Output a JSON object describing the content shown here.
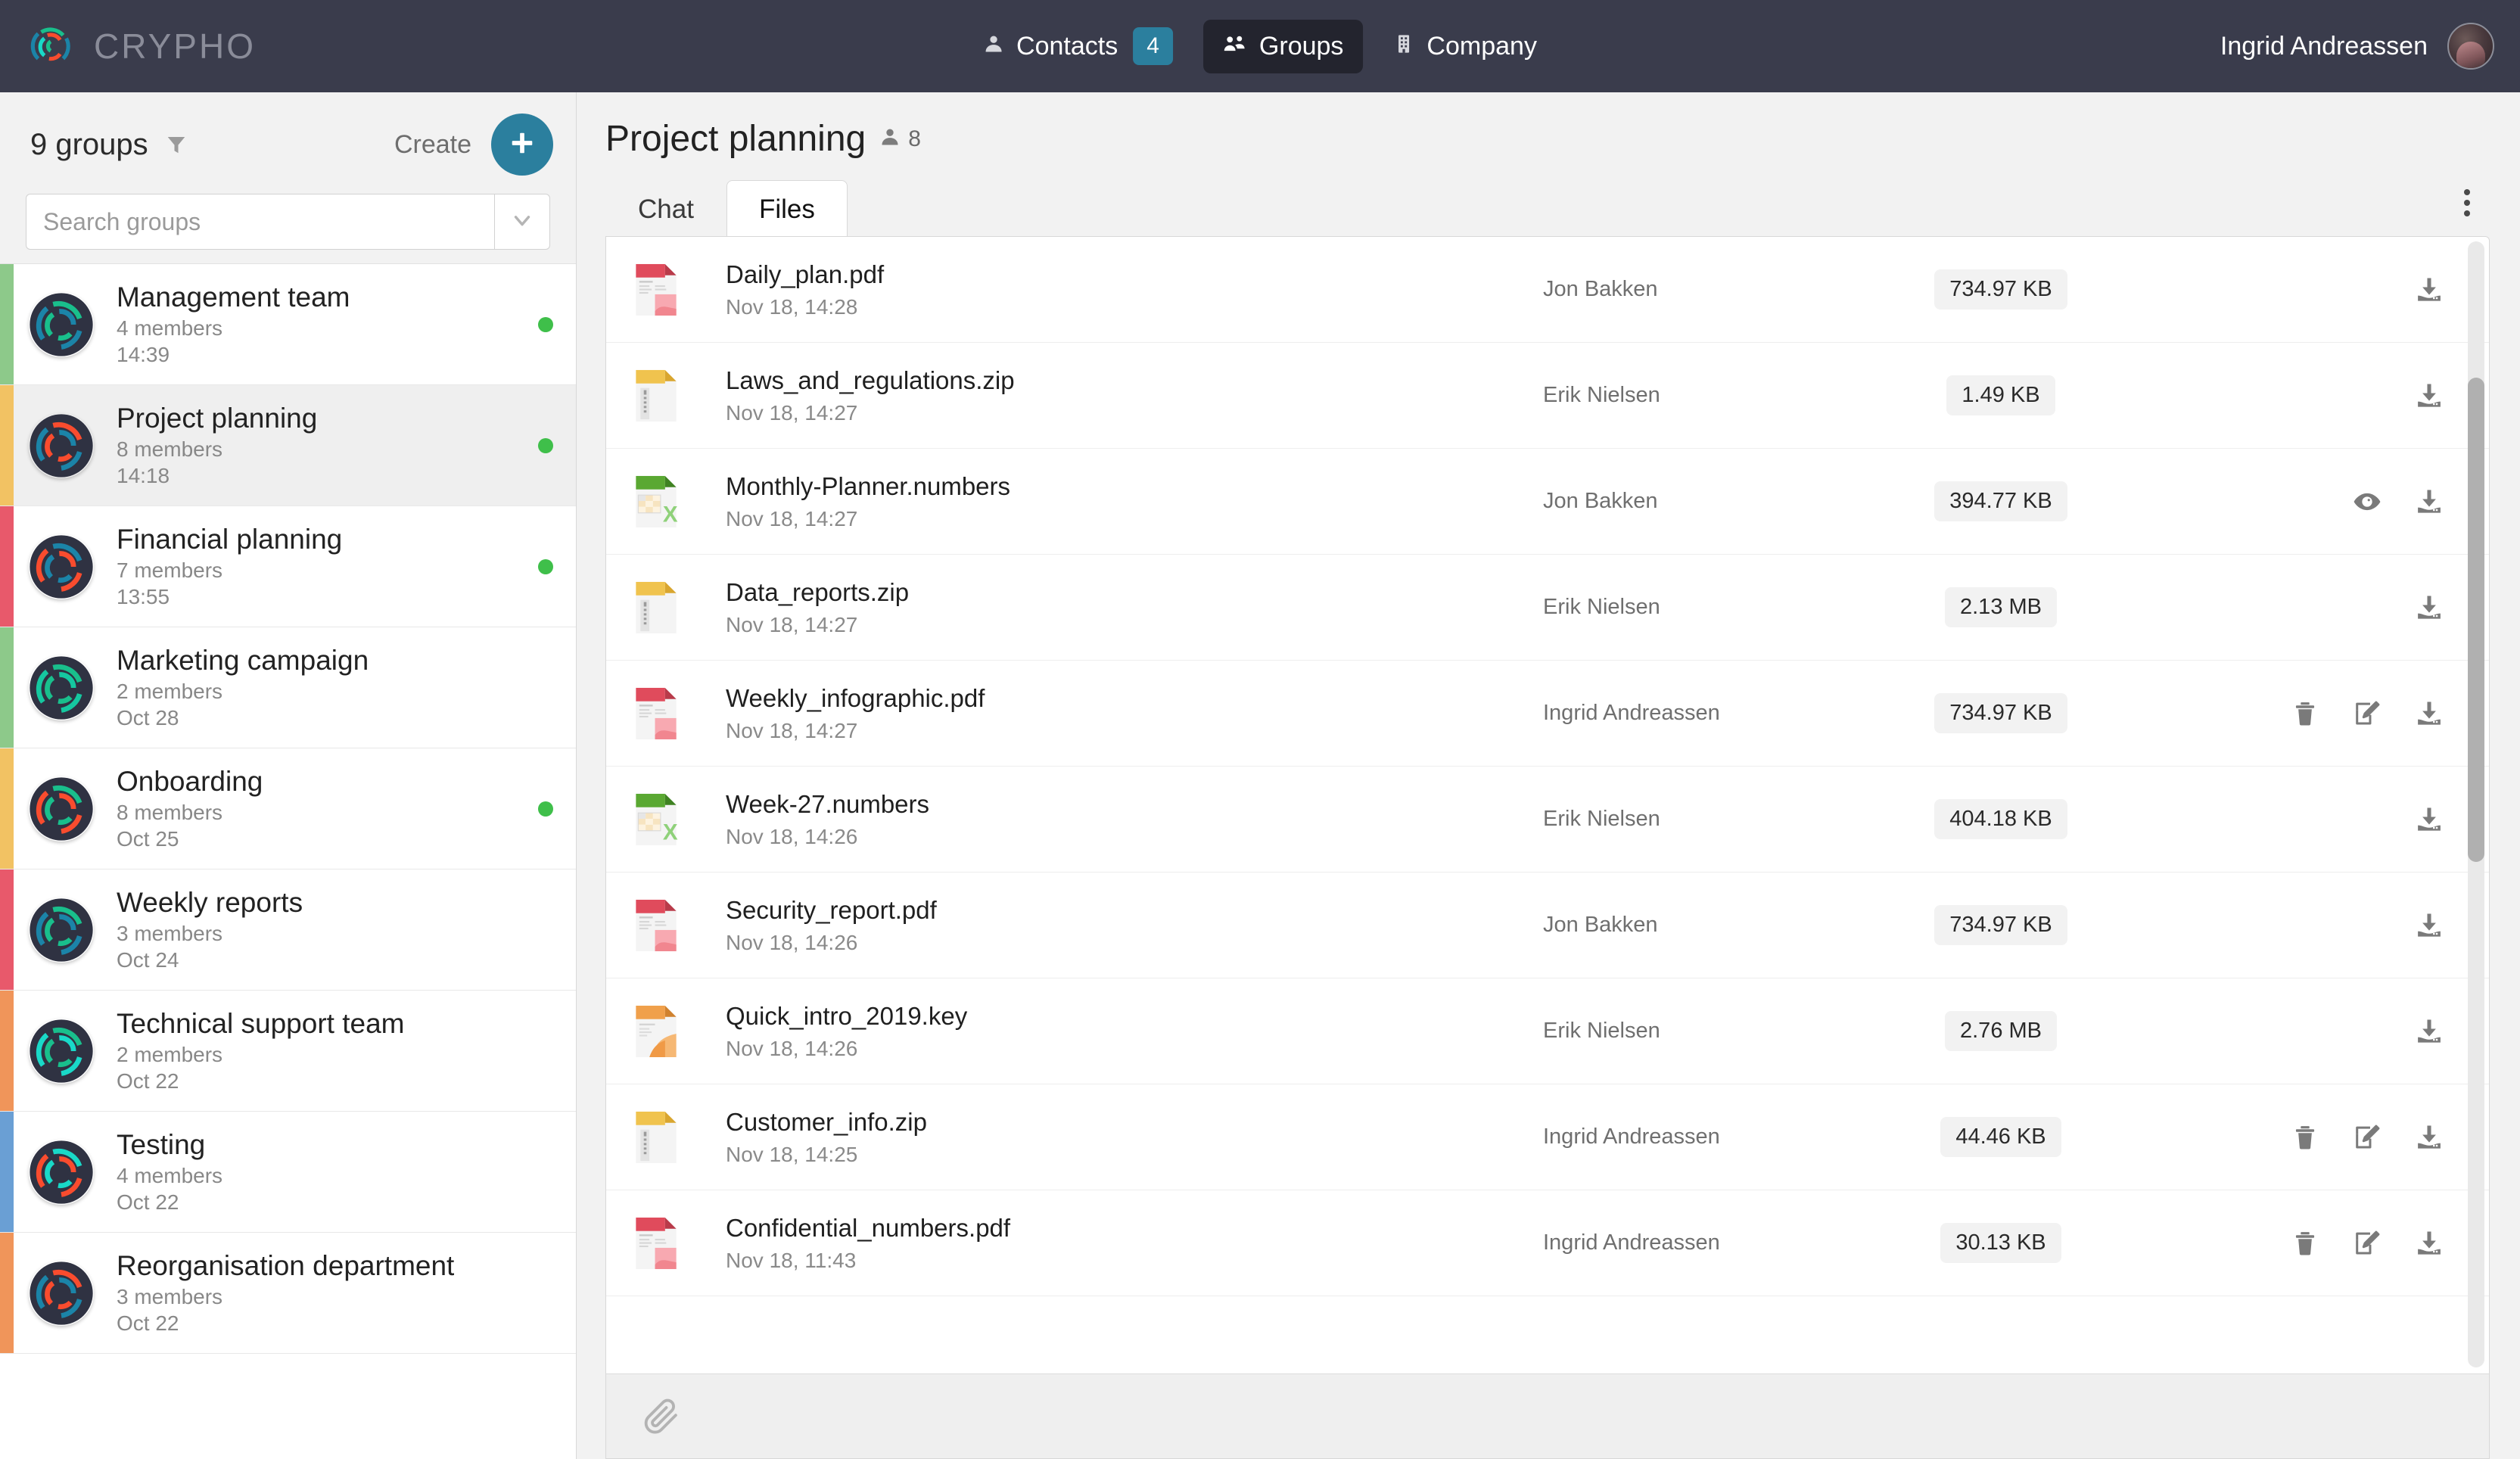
{
  "brand": {
    "name": "CRYPHO",
    "logo_icon": "crypho-logo-icon"
  },
  "navbar": {
    "items": [
      {
        "label": "Contacts",
        "icon": "user-icon",
        "badge": "4",
        "active": false
      },
      {
        "label": "Groups",
        "icon": "users-icon",
        "badge": "",
        "active": true
      },
      {
        "label": "Company",
        "icon": "building-icon",
        "badge": "",
        "active": false
      }
    ],
    "user_name": "Ingrid Andreassen",
    "avatar_icon": "user-avatar"
  },
  "sidebar": {
    "count_label": "9 groups",
    "filter_icon": "filter-icon",
    "create_label": "Create",
    "create_icon": "plus-icon",
    "search_placeholder": "Search groups",
    "search_value": "",
    "dropdown_icon": "chevron-down-icon",
    "groups": [
      {
        "name": "Management team",
        "members": "4 members",
        "time": "14:39",
        "accent": "#8dc98a",
        "online": true,
        "selected": false,
        "avatar_colors": [
          "#19bf8c",
          "#1b84a8",
          "#2f3242"
        ]
      },
      {
        "name": "Project planning",
        "members": "8 members",
        "time": "14:18",
        "accent": "#f2c263",
        "online": true,
        "selected": true,
        "avatar_colors": [
          "#f94c2e",
          "#1b84a8",
          "#2f3242"
        ]
      },
      {
        "name": "Financial planning",
        "members": "7 members",
        "time": "13:55",
        "accent": "#e8596b",
        "online": true,
        "selected": false,
        "avatar_colors": [
          "#1b84a8",
          "#f94c2e",
          "#2f3242"
        ]
      },
      {
        "name": "Marketing campaign",
        "members": "2 members",
        "time": "Oct 28",
        "accent": "#8dc98a",
        "online": false,
        "selected": false,
        "avatar_colors": [
          "#19bf8c",
          "#15c8a0",
          "#2f3242"
        ]
      },
      {
        "name": "Onboarding",
        "members": "8 members",
        "time": "Oct 25",
        "accent": "#f2c263",
        "online": true,
        "selected": false,
        "avatar_colors": [
          "#19bf8c",
          "#f94c2e",
          "#2f3242"
        ]
      },
      {
        "name": "Weekly reports",
        "members": "3 members",
        "time": "Oct 24",
        "accent": "#e8596b",
        "online": false,
        "selected": false,
        "avatar_colors": [
          "#19bf8c",
          "#1b84a8",
          "#2f3242"
        ]
      },
      {
        "name": "Technical support team",
        "members": "2 members",
        "time": "Oct 22",
        "accent": "#f0955a",
        "online": false,
        "selected": false,
        "avatar_colors": [
          "#19bf8c",
          "#19d9c8",
          "#2f3242"
        ]
      },
      {
        "name": "Testing",
        "members": "4 members",
        "time": "Oct 22",
        "accent": "#6a9fd4",
        "online": false,
        "selected": false,
        "avatar_colors": [
          "#19d9c8",
          "#f94c2e",
          "#2f3242"
        ]
      },
      {
        "name": "Reorganisation department",
        "members": "3 members",
        "time": "Oct 22",
        "accent": "#f0955a",
        "online": false,
        "selected": false,
        "avatar_colors": [
          "#f94c2e",
          "#1b84a8",
          "#2f3242"
        ]
      }
    ]
  },
  "main": {
    "title": "Project planning",
    "member_icon": "user-icon",
    "member_count": "8",
    "tabs": [
      {
        "label": "Chat",
        "active": false
      },
      {
        "label": "Files",
        "active": true
      }
    ],
    "menu_icon": "kebab-menu-icon",
    "attach_icon": "paperclip-icon",
    "files": [
      {
        "name": "Daily_plan.pdf",
        "date": "Nov 18, 14:28",
        "owner": "Jon Bakken",
        "size": "734.97 KB",
        "type": "pdf",
        "actions": [
          "download"
        ]
      },
      {
        "name": "Laws_and_regulations.zip",
        "date": "Nov 18, 14:27",
        "owner": "Erik Nielsen",
        "size": "1.49 KB",
        "type": "zip",
        "actions": [
          "download"
        ]
      },
      {
        "name": "Monthly-Planner.numbers",
        "date": "Nov 18, 14:27",
        "owner": "Jon Bakken",
        "size": "394.77 KB",
        "type": "numbers",
        "actions": [
          "preview",
          "download"
        ]
      },
      {
        "name": "Data_reports.zip",
        "date": "Nov 18, 14:27",
        "owner": "Erik Nielsen",
        "size": "2.13 MB",
        "type": "zip",
        "actions": [
          "download"
        ]
      },
      {
        "name": "Weekly_infographic.pdf",
        "date": "Nov 18, 14:27",
        "owner": "Ingrid Andreassen",
        "size": "734.97 KB",
        "type": "pdf",
        "actions": [
          "delete",
          "edit",
          "download"
        ]
      },
      {
        "name": "Week-27.numbers",
        "date": "Nov 18, 14:26",
        "owner": "Erik Nielsen",
        "size": "404.18 KB",
        "type": "numbers",
        "actions": [
          "download"
        ]
      },
      {
        "name": "Security_report.pdf",
        "date": "Nov 18, 14:26",
        "owner": "Jon Bakken",
        "size": "734.97 KB",
        "type": "pdf",
        "actions": [
          "download"
        ]
      },
      {
        "name": "Quick_intro_2019.key",
        "date": "Nov 18, 14:26",
        "owner": "Erik Nielsen",
        "size": "2.76 MB",
        "type": "key",
        "actions": [
          "download"
        ]
      },
      {
        "name": "Customer_info.zip",
        "date": "Nov 18, 14:25",
        "owner": "Ingrid Andreassen",
        "size": "44.46 KB",
        "type": "zip",
        "actions": [
          "delete",
          "edit",
          "download"
        ]
      },
      {
        "name": "Confidential_numbers.pdf",
        "date": "Nov 18, 11:43",
        "owner": "Ingrid Andreassen",
        "size": "30.13 KB",
        "type": "pdf",
        "actions": [
          "delete",
          "edit",
          "download"
        ]
      }
    ]
  },
  "colors": {
    "navbar_bg": "#3a3c4c",
    "accent_teal": "#2b7f9e",
    "online_green": "#3fbf4a",
    "page_bg": "#f2f2f2"
  }
}
